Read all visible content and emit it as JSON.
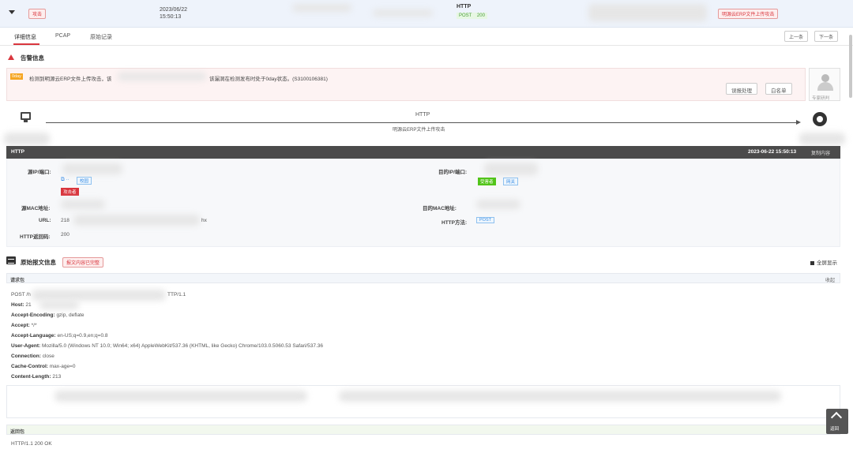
{
  "alert_row": {
    "type_tag": "攻击",
    "date": "2023/06/22",
    "time": "15:50:13",
    "protocol": "HTTP",
    "method": "POST",
    "status_code": "200",
    "event_tag": "明源云ERP文件上传攻击"
  },
  "tabs": [
    {
      "label": "详细信息"
    },
    {
      "label": "PCAP"
    },
    {
      "label": "原始记录"
    }
  ],
  "nav": {
    "prev": "上一条",
    "next": "下一条"
  },
  "alarm": {
    "title": "告警信息",
    "badge": "0day",
    "text_prefix": "检测到明源云ERP文件上传攻击，该",
    "text_suffix": "该漏洞在检测发布时处于0day状态。(S3100106381)",
    "handle_btn": "误报处理",
    "whitelist_btn": "白名单",
    "expert_label": "专家研判"
  },
  "flow": {
    "protocol": "HTTP",
    "description": "明源云ERP文件上传攻击"
  },
  "http_bar": {
    "label": "HTTP",
    "timestamp": "2023-06-22 15:50:13",
    "copy": "复制内容"
  },
  "detail": {
    "src_label": "源IP/端口:",
    "src_attacker": "攻击者",
    "src_chip": "校园",
    "dst_label": "目的IP/端口:",
    "dst_victim": "受害者",
    "dst_chip": "网关",
    "src_mac_label": "源MAC地址:",
    "dst_mac_label": "目的MAC地址:",
    "url_label": "URL:",
    "url_prefix": "218",
    "url_suffix": "hx",
    "method_label": "HTTP方法:",
    "method_value": "POST",
    "status_label": "HTTP返回码:",
    "status_value": "200"
  },
  "raw": {
    "title": "原始报文信息",
    "tag": "报文内容已完整",
    "full_display": "全屏显示",
    "request_title": "请求包",
    "collapse": "收起",
    "request_line_prefix": "POST /h",
    "request_line_suffix": "TTP/1.1",
    "headers": [
      {
        "k": "Host:",
        "v": "21"
      },
      {
        "k": "Accept-Encoding:",
        "v": "gzip, deflate"
      },
      {
        "k": "Accept:",
        "v": "*/*"
      },
      {
        "k": "Accept-Language:",
        "v": "en-US;q=0.9,en;q=0.8"
      },
      {
        "k": "User-Agent:",
        "v": "Mozilla/5.0 (Windows NT 10.0; Win64; x64) AppleWebKit/537.36 (KHTML, like Gecko) Chrome/103.0.5060.53 Safari/537.36"
      },
      {
        "k": "Connection:",
        "v": "close"
      },
      {
        "k": "Cache-Control:",
        "v": "max-age=0"
      },
      {
        "k": "Content-Length:",
        "v": "213"
      }
    ],
    "response_title": "返回包",
    "response_line": "HTTP/1.1 200 OK"
  },
  "back_top": "返回"
}
